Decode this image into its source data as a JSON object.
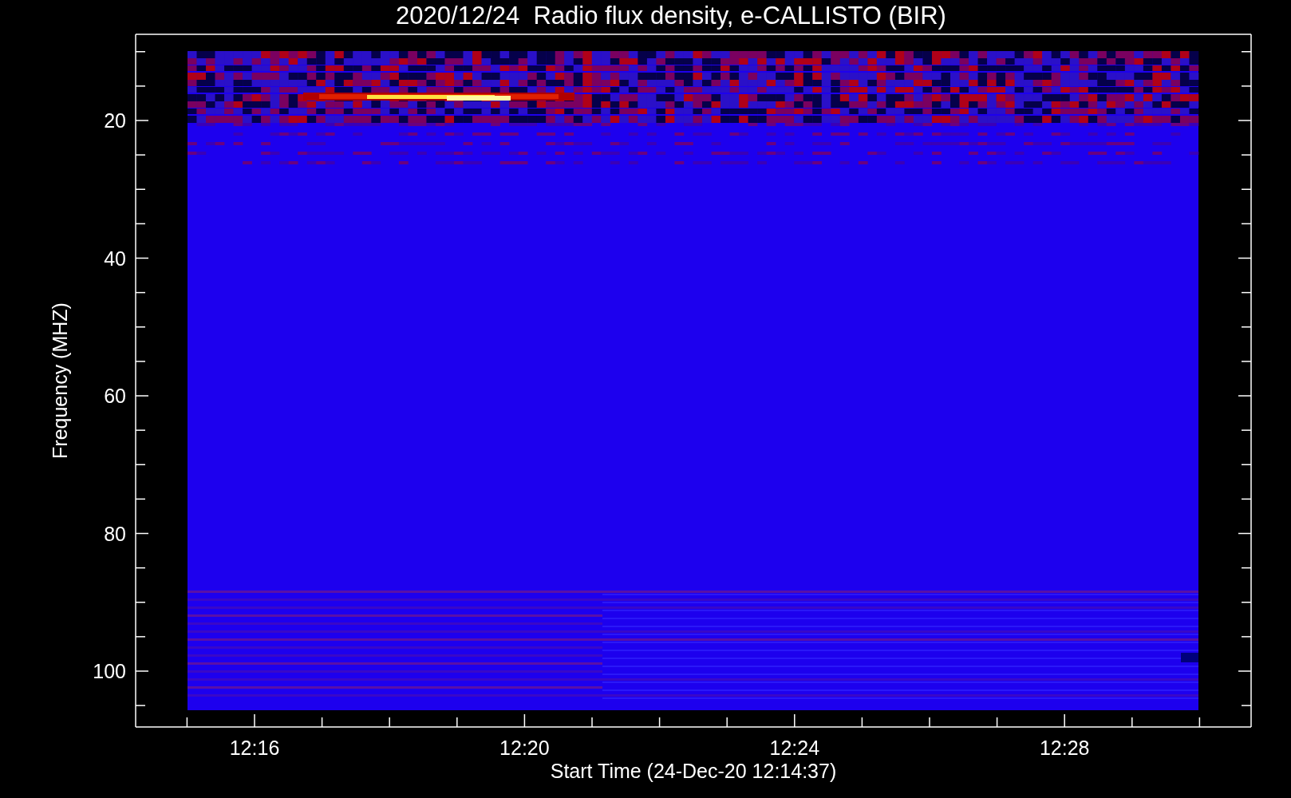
{
  "title": "2020/12/24  Radio flux density, e-CALLISTO (BIR)",
  "y_axis": {
    "label": "Frequency (MHZ)",
    "ticks": [
      "20",
      "40",
      "60",
      "80",
      "100"
    ]
  },
  "x_axis": {
    "label": "Start Time (24-Dec-20 12:14:37)",
    "ticks": [
      "12:16",
      "12:20",
      "12:24",
      "12:28"
    ]
  }
}
